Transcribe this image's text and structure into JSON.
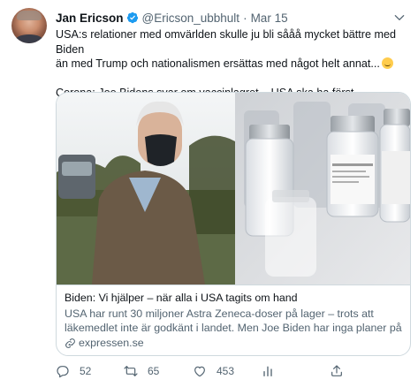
{
  "tweet": {
    "author_name": "Jan Ericson",
    "handle": "@Ericson_ubbhult",
    "separator": "·",
    "date": "Mar 15",
    "text_line1": "USA:s relationer med omvärlden skulle ju bli sååå mycket bättre med Biden",
    "text_line2": "än med Trump och nationalismen ersättas med något helt annat...",
    "text_line3": "Corona: Joe Bidens svar om vaccinlagret – USA ska ha först"
  },
  "card": {
    "title": "Biden: Vi hjälper – när alla i USA tagits om hand",
    "description": "USA har runt 30 miljoner Astra Zeneca-doser på lager – trots att läkemedlet inte är godkänt i landet. Men Joe Biden har inga planer på ...",
    "domain": "expressen.se"
  },
  "actions": {
    "reply_count": "52",
    "retweet_count": "65",
    "like_count": "453"
  },
  "icons": [
    "verified-badge-icon",
    "chevron-down-icon",
    "emoji-icon",
    "link-icon",
    "reply-icon",
    "retweet-icon",
    "like-icon",
    "analytics-icon",
    "share-icon"
  ],
  "colors": {
    "accent": "#1d9bf0",
    "secondary_text": "#536471",
    "border": "#cfd9de"
  }
}
